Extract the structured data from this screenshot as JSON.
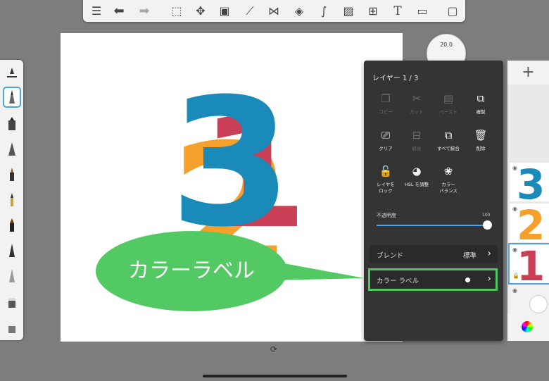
{
  "toolbar": {
    "icons": [
      "list-icon",
      "undo-icon",
      "redo-icon",
      "select-icon",
      "move-icon",
      "layer-icon",
      "ruler-icon",
      "symmetry-icon",
      "shape-icon",
      "curve-icon",
      "image-icon",
      "perspective-icon",
      "text-icon",
      "video-icon",
      "fullscreen-icon"
    ],
    "text_glyph": "T"
  },
  "brush_puck": {
    "value": "20.0"
  },
  "canvas": {
    "numbers": [
      {
        "text": "2",
        "color": "#f5a02a"
      },
      {
        "text": "1",
        "color": "#c93f55"
      },
      {
        "text": "3",
        "color": "#1a8ab8"
      }
    ]
  },
  "layer_panel": {
    "title": "レイヤー 1 / 3",
    "actions": [
      {
        "label": "コピー",
        "enabled": false
      },
      {
        "label": "カット",
        "enabled": false
      },
      {
        "label": "ペースト",
        "enabled": false
      },
      {
        "label": "複製",
        "enabled": true
      },
      {
        "label": "クリア",
        "enabled": true
      },
      {
        "label": "統合",
        "enabled": false
      },
      {
        "label": "すべて統合",
        "enabled": true
      },
      {
        "label": "削除",
        "enabled": true
      },
      {
        "label": "レイヤを\nロック",
        "enabled": true
      },
      {
        "label": "HSL を調整",
        "enabled": true
      },
      {
        "label": "カラー\nバランス",
        "enabled": true
      }
    ],
    "opacity_label": "不透明度",
    "opacity_value": "100",
    "blend_label": "ブレンド",
    "blend_value": "標準",
    "color_label": "カラー ラベル"
  },
  "layers_column": {
    "add_glyph": "+",
    "thumbs": [
      {
        "text": "3",
        "color": "#1a8ab8"
      },
      {
        "text": "2",
        "color": "#f5a02a"
      },
      {
        "text": "1",
        "color": "#c93f55"
      }
    ]
  },
  "callout": {
    "text": "カラーラベル"
  },
  "colors": {
    "highlight": "#4fc85f",
    "panel": "#343434",
    "accent": "#4da3e8"
  }
}
